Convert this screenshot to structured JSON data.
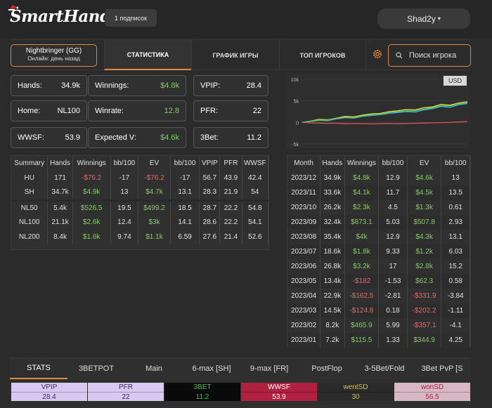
{
  "header": {
    "logo_text": "SmartHand",
    "subscription_button": "1 подписок",
    "user_name": "Shad2y"
  },
  "nav": {
    "player_name": "Nightbringer (GG)",
    "player_status": "Онлайн: день назад",
    "tabs": [
      "СТАТИСТИКА",
      "ГРАФИК ИГРЫ",
      "ТОП ИГРОКОВ"
    ],
    "search_placeholder": "Поиск игрока"
  },
  "stats": [
    {
      "label": "Hands:",
      "value": "34.9k",
      "color": "white"
    },
    {
      "label": "Winnings:",
      "value": "$4.8k",
      "color": "green"
    },
    {
      "label": "VPIP:",
      "value": "28.4",
      "color": "white"
    },
    {
      "label": "Home:",
      "value": "NL100",
      "color": "white"
    },
    {
      "label": "Winrate:",
      "value": "12.8",
      "color": "green"
    },
    {
      "label": "PFR:",
      "value": "22",
      "color": "white"
    },
    {
      "label": "WWSF:",
      "value": "53.9",
      "color": "white"
    },
    {
      "label": "Expected V:",
      "value": "$4.6k",
      "color": "green"
    },
    {
      "label": "3Bet:",
      "value": "11.2",
      "color": "white"
    }
  ],
  "summary": {
    "headers": [
      "Summary",
      "Hands",
      "Winnings",
      "bb/100",
      "EV",
      "bb/100",
      "VPIP",
      "PFR",
      "WWSF"
    ],
    "rows": [
      {
        "cells": [
          "HU",
          "171",
          "-$76.2",
          "-17",
          "-$76.2",
          "-17",
          "56.7",
          "43.9",
          "42.4"
        ],
        "colors": [
          "",
          "",
          "r",
          "",
          "r",
          "",
          "",
          "",
          ""
        ],
        "sep": false
      },
      {
        "cells": [
          "SH",
          "34.7k",
          "$4.9k",
          "13",
          "$4.7k",
          "13.1",
          "28.3",
          "21.9",
          "54"
        ],
        "colors": [
          "",
          "",
          "g",
          "",
          "g",
          "",
          "",
          "",
          ""
        ],
        "sep": false
      },
      {
        "cells": [
          "NL50",
          "5.4k",
          "$526.5",
          "19.5",
          "$499.2",
          "18.5",
          "28.7",
          "22.2",
          "54.8"
        ],
        "colors": [
          "",
          "",
          "g",
          "",
          "g",
          "",
          "",
          "",
          ""
        ],
        "sep": true
      },
      {
        "cells": [
          "NL100",
          "21.1k",
          "$2.6k",
          "12.4",
          "$3k",
          "14.1",
          "28.6",
          "22.2",
          "54.1"
        ],
        "colors": [
          "",
          "",
          "g",
          "",
          "g",
          "",
          "",
          "",
          ""
        ],
        "sep": false
      },
      {
        "cells": [
          "NL200",
          "8.4k",
          "$1.6k",
          "9.74",
          "$1.1k",
          "6.59",
          "27.6",
          "21.4",
          "52.6"
        ],
        "colors": [
          "",
          "",
          "g",
          "",
          "g",
          "",
          "",
          "",
          ""
        ],
        "sep": false
      }
    ]
  },
  "monthly": {
    "headers": [
      "Month",
      "Hands",
      "Winnings",
      "bb/100",
      "EV",
      "bb/100"
    ],
    "rows": [
      {
        "cells": [
          "2023/12",
          "34.9k",
          "$4.8k",
          "12.9",
          "$4.6k",
          "13"
        ],
        "colors": [
          "",
          "",
          "g",
          "",
          "g",
          ""
        ]
      },
      {
        "cells": [
          "2023/11",
          "33.6k",
          "$4.1k",
          "11.7",
          "$4.5k",
          "13.5"
        ],
        "colors": [
          "",
          "",
          "g",
          "",
          "g",
          ""
        ]
      },
      {
        "cells": [
          "2023/10",
          "26.2k",
          "$2.3k",
          "4.5",
          "$1.3k",
          "0.61"
        ],
        "colors": [
          "",
          "",
          "g",
          "",
          "g",
          ""
        ]
      },
      {
        "cells": [
          "2023/09",
          "32.4k",
          "$873.1",
          "5.03",
          "$507.8",
          "2.93"
        ],
        "colors": [
          "",
          "",
          "g",
          "",
          "g",
          ""
        ]
      },
      {
        "cells": [
          "2023/08",
          "35.4k",
          "$4k",
          "12.9",
          "$4.3k",
          "13.1"
        ],
        "colors": [
          "",
          "",
          "g",
          "",
          "g",
          ""
        ]
      },
      {
        "cells": [
          "2023/07",
          "18.6k",
          "$1.8k",
          "9.33",
          "$1.2k",
          "6.03"
        ],
        "colors": [
          "",
          "",
          "g",
          "",
          "g",
          ""
        ]
      },
      {
        "cells": [
          "2023/06",
          "26.8k",
          "$3.2k",
          "17",
          "$2.8k",
          "15.2"
        ],
        "colors": [
          "",
          "",
          "g",
          "",
          "g",
          ""
        ]
      },
      {
        "cells": [
          "2023/05",
          "13.4k",
          "-$182",
          "-1.53",
          "$62.3",
          "0.58"
        ],
        "colors": [
          "",
          "",
          "r",
          "",
          "g",
          ""
        ]
      },
      {
        "cells": [
          "2023/04",
          "22.9k",
          "-$162.5",
          "-2.81",
          "-$331.9",
          "-3.84"
        ],
        "colors": [
          "",
          "",
          "r",
          "",
          "r",
          ""
        ]
      },
      {
        "cells": [
          "2023/03",
          "14.5k",
          "-$124.8",
          "0.18",
          "-$202.2",
          "-1.11"
        ],
        "colors": [
          "",
          "",
          "r",
          "",
          "r",
          ""
        ]
      },
      {
        "cells": [
          "2023/02",
          "8.2k",
          "$465.9",
          "5.99",
          "-$357.1",
          "-4.1"
        ],
        "colors": [
          "",
          "",
          "g",
          "",
          "r",
          ""
        ]
      },
      {
        "cells": [
          "2023/01",
          "7.2k",
          "$115.5",
          "1.33",
          "$344.9",
          "4.25"
        ],
        "colors": [
          "",
          "",
          "g",
          "",
          "g",
          ""
        ]
      }
    ]
  },
  "chart_data": {
    "type": "line",
    "currency_badge": "USD",
    "y_ticks": [
      "10k",
      "5k",
      "0",
      "-5k"
    ],
    "ylim": [
      -5000,
      10000
    ],
    "series": [
      {
        "color": "#e8e040",
        "values": [
          0,
          300,
          700,
          600,
          1000,
          1400,
          1300,
          1700,
          2000,
          2100,
          2500,
          2700,
          3000,
          2900,
          3400,
          3600,
          4200,
          4000,
          4500,
          4800
        ]
      },
      {
        "color": "#4ab0e0",
        "values": [
          0,
          200,
          500,
          400,
          800,
          1100,
          1000,
          1400,
          1600,
          1800,
          2100,
          2300,
          2500,
          2400,
          2900,
          3200,
          3700,
          3500,
          4100,
          4400
        ]
      },
      {
        "color": "#50c070",
        "values": [
          0,
          250,
          550,
          500,
          900,
          1200,
          1100,
          1500,
          1800,
          1900,
          2300,
          2500,
          2700,
          2700,
          3100,
          3400,
          3900,
          3800,
          4300,
          4600
        ]
      },
      {
        "color": "#e05050",
        "values": [
          0,
          -100,
          -150,
          -200,
          -150,
          -300,
          -250,
          -300,
          -350,
          -300,
          -250,
          -300,
          -250,
          -200,
          -150,
          -100,
          -50,
          0,
          100,
          200
        ]
      }
    ]
  },
  "bottom": {
    "tabs": [
      "STATS",
      "3BETPOT",
      "Main",
      "6-max [SH]",
      "9-max [FR]",
      "PostFlop",
      "3-5Bet/Fold",
      "3Bet PvP [S"
    ],
    "cells": [
      {
        "label": "VPIP",
        "value": "28.4",
        "bg": "#d9c8f0",
        "fg": "#3a2a6a"
      },
      {
        "label": "PFR",
        "value": "22",
        "bg": "#d9c8f0",
        "fg": "#3a2a6a"
      },
      {
        "label": "3BET",
        "value": "11.2",
        "bg": "#0a0a0a",
        "fg": "#4ac04a"
      },
      {
        "label": "WWSF",
        "value": "53.9",
        "bg": "#b02040",
        "fg": "#ffffff"
      },
      {
        "label": "wentSD",
        "value": "30",
        "bg": "#2a2a2a",
        "fg": "#d0c060"
      },
      {
        "label": "wonSD",
        "value": "56.5",
        "bg": "#d8b8c4",
        "fg": "#b02040"
      }
    ]
  }
}
